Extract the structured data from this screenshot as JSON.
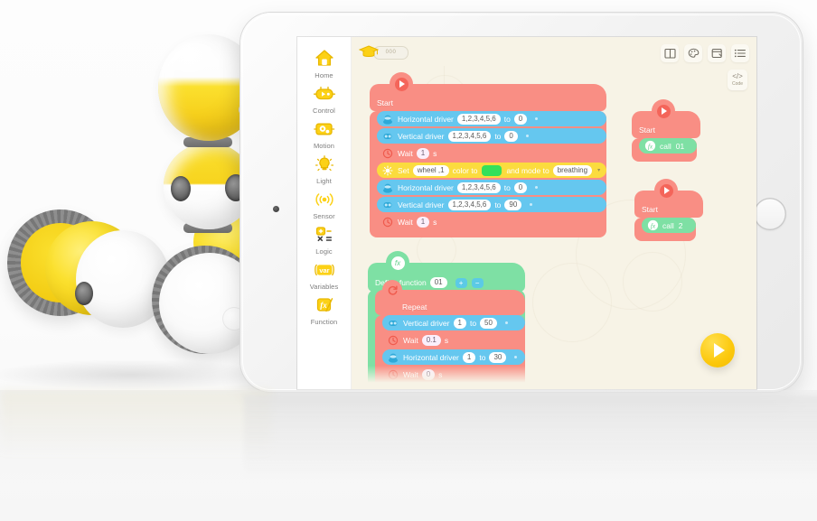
{
  "app": {
    "sidebar": {
      "items": [
        {
          "label": "Home",
          "icon": "home-icon"
        },
        {
          "label": "Control",
          "icon": "control-robot-icon"
        },
        {
          "label": "Motion",
          "icon": "motion-gear-icon"
        },
        {
          "label": "Light",
          "icon": "lightbulb-icon"
        },
        {
          "label": "Sensor",
          "icon": "sensor-waves-icon"
        },
        {
          "label": "Logic",
          "icon": "logic-operators-icon"
        },
        {
          "label": "Variables",
          "icon": "variables-var-icon"
        },
        {
          "label": "Function",
          "icon": "function-fx-icon"
        }
      ]
    },
    "toolbar": {
      "course_badge": {
        "icon": "graduation-cap-icon",
        "label": "000"
      },
      "buttons": [
        {
          "name": "tutorial-book-button",
          "icon": "book-icon"
        },
        {
          "name": "appearance-button",
          "icon": "palette-icon"
        },
        {
          "name": "save-project-button",
          "icon": "save-window-icon"
        },
        {
          "name": "menu-list-button",
          "icon": "list-icon"
        }
      ],
      "code_button": {
        "glyph": "</>",
        "label": "Code"
      },
      "run_button": {
        "name": "run-play-button",
        "icon": "play-triangle-icon"
      }
    },
    "canvas": {
      "bg_color": "#f7f3e6",
      "main_stack": {
        "hat_label": "Start",
        "blocks": [
          {
            "type": "horizontal-driver",
            "color": "#65c7ef",
            "label": "Horizontal driver",
            "port": "1,2,3,4,5,6",
            "to": "to",
            "value": "0",
            "unit": "°"
          },
          {
            "type": "vertical-driver",
            "color": "#65c7ef",
            "label": "Vertical driver",
            "port": "1,2,3,4,5,6",
            "to": "to",
            "value": "0",
            "unit": "°"
          },
          {
            "type": "wait",
            "color": "#f98e84",
            "label": "Wait",
            "value": "1",
            "unit": "s"
          },
          {
            "type": "set-light",
            "color": "#fbdc3e",
            "label": "Set",
            "target": "wheel ,1",
            "mid": "color to",
            "swatch": "#34e05a",
            "mid2": "and mode to",
            "mode": "breathing"
          },
          {
            "type": "horizontal-driver",
            "color": "#65c7ef",
            "label": "Horizontal driver",
            "port": "1,2,3,4,5,6",
            "to": "to",
            "value": "0",
            "unit": "°"
          },
          {
            "type": "vertical-driver",
            "color": "#65c7ef",
            "label": "Vertical driver",
            "port": "1,2,3,4,5,6",
            "to": "to",
            "value": "90",
            "unit": "°"
          },
          {
            "type": "wait",
            "color": "#f98e84",
            "label": "Wait",
            "value": "1",
            "unit": "s"
          }
        ]
      },
      "side_stacks": [
        {
          "hat_label": "Start",
          "call_label": "call",
          "call_value": "01"
        },
        {
          "hat_label": "Start",
          "call_label": "call",
          "call_value": "2"
        }
      ],
      "function_stack": {
        "hat_label": "Define function",
        "function_id": "01",
        "add_label": "+",
        "remove_label": "−",
        "repeat_label": "Repeat",
        "blocks": [
          {
            "type": "vertical-driver",
            "color": "#65c7ef",
            "label": "Vertical driver",
            "port": "1",
            "to": "to",
            "value": "50",
            "unit": "°"
          },
          {
            "type": "wait",
            "color": "#f98e84",
            "label": "Wait",
            "value": "0.1",
            "unit": "s"
          },
          {
            "type": "horizontal-driver",
            "color": "#65c7ef",
            "label": "Horizontal driver",
            "port": "1",
            "to": "to",
            "value": "30",
            "unit": "°"
          },
          {
            "type": "wait",
            "color": "#f98e84",
            "label": "Wait",
            "value": "0",
            "unit": "s"
          }
        ]
      }
    }
  }
}
